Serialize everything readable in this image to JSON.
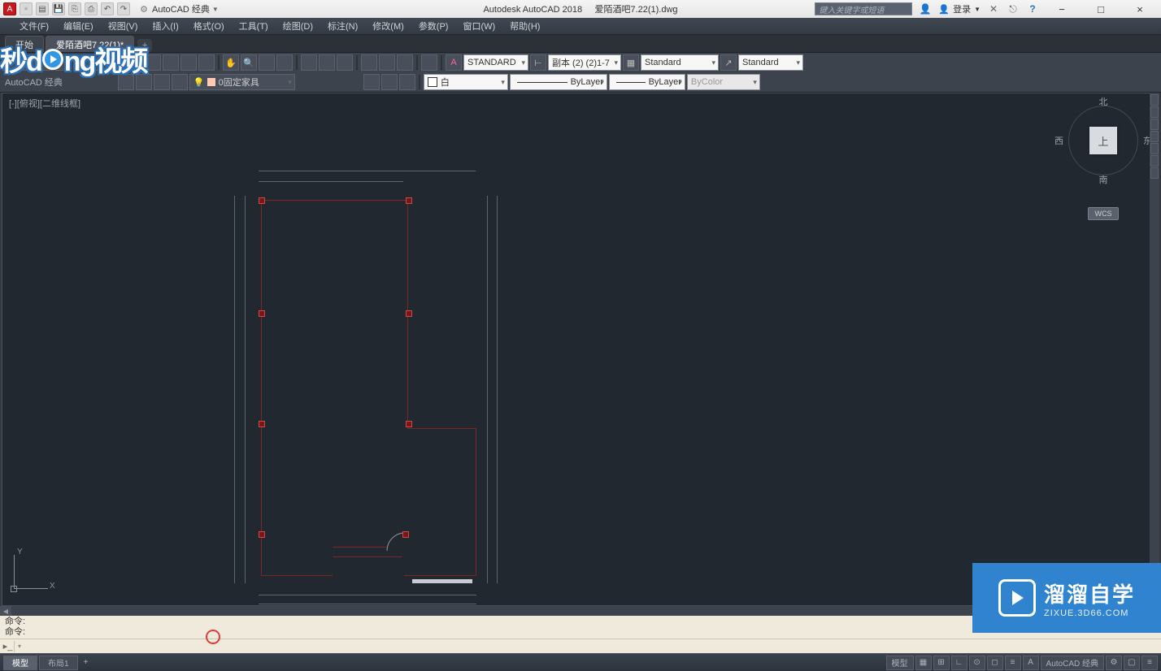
{
  "titlebar": {
    "workspace_label": "AutoCAD 经典",
    "title_app": "Autodesk AutoCAD 2018",
    "title_file": "爱陌酒吧7.22(1).dwg",
    "search_placeholder": "键入关键字或短语",
    "login_label": "登录",
    "min": "−",
    "max": "□",
    "close": "×"
  },
  "menus": [
    "文件(F)",
    "编辑(E)",
    "视图(V)",
    "插入(I)",
    "格式(O)",
    "工具(T)",
    "绘图(D)",
    "标注(N)",
    "修改(M)",
    "参数(P)",
    "窗口(W)",
    "帮助(H)"
  ],
  "filetabs": {
    "start": "开始",
    "active": "爱陌酒吧7.22(1)*"
  },
  "breadcrumb": "AutoCAD 经典",
  "layer_dd": "0固定家具",
  "dd_text_style": "STANDARD",
  "dd_dim_style": "副本 (2) (2)1-7",
  "dd_table_style": "Standard",
  "dd_mleader_style": "Standard",
  "dd_color": "白",
  "dd_linetype": "ByLayer",
  "dd_lineweight": "ByLayer",
  "dd_plot_style": "ByColor",
  "view_label": "[-][俯视][二维线框]",
  "navcube": {
    "top": "上",
    "n": "北",
    "s": "南",
    "e": "东",
    "w": "西",
    "wcs": "WCS"
  },
  "ucs": {
    "x": "X",
    "y": "Y"
  },
  "cmd_history": [
    "命令:",
    "命令:"
  ],
  "cmd_input": "",
  "status_tabs": {
    "model": "模型",
    "layout": "布局1"
  },
  "status_right": {
    "model_btn": "模型",
    "scale_label": "AutoCAD 经典"
  },
  "banner": {
    "line1": "溜溜自学",
    "line2": "ZIXUE.3D66.COM"
  },
  "logo": {
    "t1": "秒d",
    "t2": "ng视频"
  }
}
